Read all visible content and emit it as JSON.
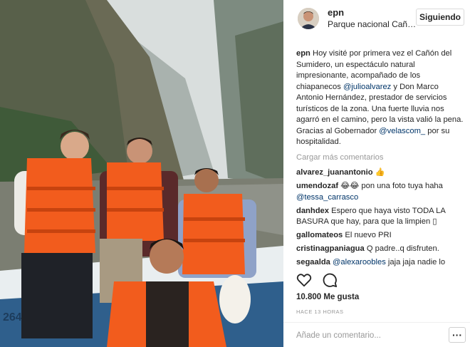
{
  "post": {
    "username": "epn",
    "location": "Parque nacional Cañón del Sumidero",
    "follow_label": "Siguiendo",
    "photo_alt": "Foto en lancha en el Cañón del Sumidero",
    "caption": {
      "user": "epn",
      "text_1": " Hoy visité por primera vez el Cañón del Sumidero, un espectáculo natural impresionante, acompañado de los chiapanecos ",
      "mention_1": "@julioalvarez",
      "text_2": " y Don Marco Antonio Hernández, prestador de servicios turísticos de la zona. Una fuerte lluvia nos agarró en el camino, pero la vista valió la pena. Gracias al Gobernador ",
      "mention_2": "@velascom_",
      "text_3": " por su hospitalidad."
    },
    "load_more_label": "Cargar más comentarios",
    "comments": [
      {
        "user": "alvarez_juanantonio",
        "text": " 👍"
      },
      {
        "user": "umendozaf",
        "text": " 😂😂 pon una foto tuya haha ",
        "mention": "@tessa_carrasco",
        "after": ""
      },
      {
        "user": "danhdex",
        "text": " Espero que haya visto TODA LA BASURA que hay, para que la limpien ▯"
      },
      {
        "user": "gallomateos",
        "text": " El nuevo PRI"
      },
      {
        "user": "cristinagpaniagua",
        "text": " Q padre..q disfruten."
      },
      {
        "user": "segaalda",
        "text": " ",
        "mention": "@alexaroobles",
        "after": " jaja jaja nadie lo"
      }
    ],
    "likes": "10.800 Me gusta",
    "timestamp": "HACE 13 HORAS",
    "add_comment_placeholder": "Añade un comentario...",
    "more_label": "···"
  }
}
